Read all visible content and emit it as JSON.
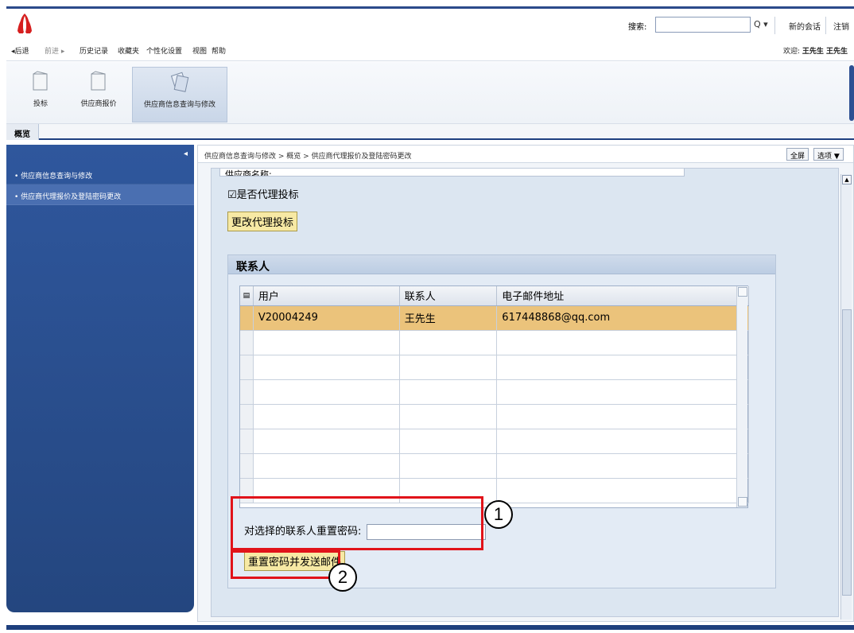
{
  "topbar": {
    "search_label": "搜索:",
    "search_placeholder": "",
    "search_button": "Q ▾",
    "new_session": "新的会话",
    "logout": "注销"
  },
  "menubar": {
    "back": "◂后退",
    "forward": "前进 ▸",
    "history": "历史记录",
    "favorites": "收藏夹",
    "personalize": "个性化设置",
    "view": "视图",
    "help": "帮助",
    "welcome_prefix": "欢迎:",
    "welcome_user": "王先生 王先生"
  },
  "toolbar": {
    "items": [
      {
        "label": "投标"
      },
      {
        "label": "供应商报价"
      },
      {
        "label": "供应商信息查询与修改"
      }
    ]
  },
  "tabs": {
    "overview": "概览"
  },
  "leftnav": {
    "items": [
      {
        "label": "• 供应商信息查询与修改"
      },
      {
        "label": "• 供应商代理报价及登陆密码更改"
      }
    ]
  },
  "content": {
    "breadcrumb": "供应商信息查询与修改 > 概览 > 供应商代理报价及登陆密码更改",
    "fullscreen": "全屏",
    "options": "选项 ▼",
    "vendor_field_partial": "供应商名称:",
    "proxy_checkbox_label": "☑是否代理投标",
    "change_proxy_button": "更改代理投标",
    "contacts_group_title": "联系人",
    "grid": {
      "headers": [
        "用户",
        "联系人",
        "电子邮件地址"
      ],
      "rows": [
        [
          "V20004249",
          "王先生",
          "617448868@qq.com"
        ]
      ]
    },
    "reset_label": "对选择的联系人重置密码:",
    "reset_value": "",
    "reset_button": "重置密码并发送邮件",
    "callout_1": "1",
    "callout_2": "2"
  },
  "colors": {
    "brand_blue": "#24467f",
    "selected_row": "#ebc37b",
    "highlight_red": "#e1131a",
    "button_yellow": "#f7e9a4"
  }
}
